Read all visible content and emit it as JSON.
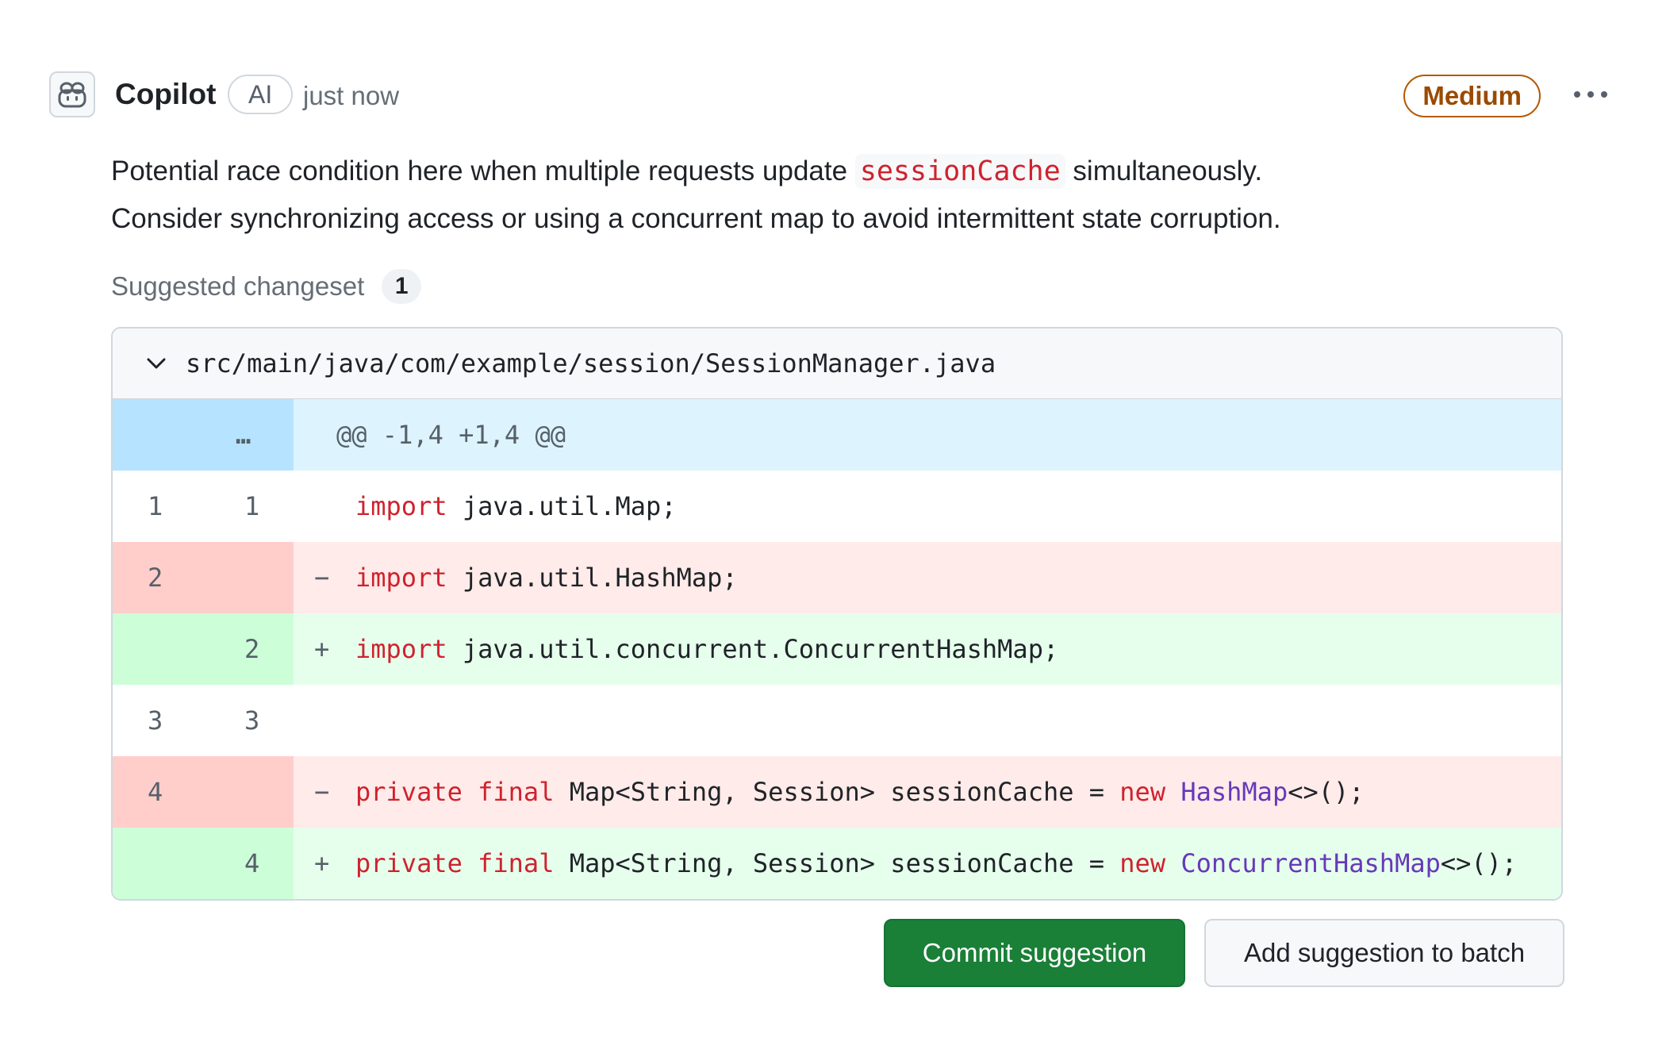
{
  "comment": {
    "author": "Copilot",
    "author_badge": "AI",
    "timestamp": "just now",
    "priority": "Medium",
    "priority_color": "#9a4a00",
    "avatar_icon": "copilot-icon",
    "more_icon": "kebab-horizontal-icon",
    "message": {
      "part1": "Potential race condition here when multiple requests update ",
      "code": "sessionCache",
      "part2": " simultaneously.",
      "line2": "Consider synchronizing access or using a concurrent map to avoid intermittent state corruption."
    }
  },
  "changeset": {
    "label": "Suggested changeset",
    "count": "1"
  },
  "diff": {
    "file_path": "src/main/java/com/example/session/SessionManager.java",
    "collapse_icon": "chevron-down-icon",
    "hunk_dots": "…",
    "hunk_header": "@@ -1,4 +1,4 @@",
    "lines": [
      {
        "type": "context",
        "old": "1",
        "new": "1",
        "marker": "",
        "kw": "import",
        "rest": " java.util.Map;"
      },
      {
        "type": "del",
        "old": "2",
        "new": "",
        "marker": "−",
        "kw": "import",
        "rest": " java.util.HashMap;"
      },
      {
        "type": "add",
        "old": "",
        "new": "2",
        "marker": "+",
        "kw": "import",
        "rest": " java.util.concurrent.ConcurrentHashMap;"
      },
      {
        "type": "context",
        "old": "3",
        "new": "3",
        "marker": "",
        "kw": "",
        "rest": ""
      },
      {
        "type": "del",
        "old": "4",
        "new": "",
        "marker": "−",
        "kw1": "private",
        "kw2": "final",
        "mid": " Map<String, Session> sessionCache = ",
        "kw3": "new",
        "type_name": "HashMap",
        "end": "<>();"
      },
      {
        "type": "add",
        "old": "",
        "new": "4",
        "marker": "+",
        "kw1": "private",
        "kw2": "final",
        "mid": " Map<String, Session> sessionCache = ",
        "kw3": "new",
        "type_name": "ConcurrentHashMap",
        "end": "<>();"
      }
    ]
  },
  "actions": {
    "commit_label": "Commit suggestion",
    "batch_label": "Add suggestion to batch",
    "commit_color": "#1a7f37"
  }
}
